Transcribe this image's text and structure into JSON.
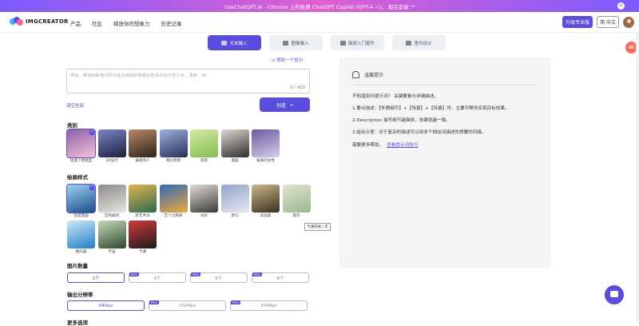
{
  "banner": {
    "text": "UseChatGPT.AI - Chrome 上的免费 ChatGPT Copilot (GPT-4 ✓)。 现在安装",
    "arrow": "→",
    "close": "×"
  },
  "brand": {
    "name": "IMGCREATOR",
    "colors": [
      "#3ab0ff",
      "#5b4ce0",
      "#ff5f8f"
    ]
  },
  "nav": {
    "items": [
      "产品",
      "社区",
      "释放你的想象力",
      "历史记录"
    ],
    "pro": "升级专业版",
    "lang": "简 中文"
  },
  "modes": [
    {
      "label": "文本输入",
      "icon": "text-icon",
      "active": true
    },
    {
      "label": "图像输入",
      "icon": "image-icon",
      "active": false
    },
    {
      "label": "面部入门套件",
      "icon": "face-icon",
      "active": false
    },
    {
      "label": "室内设计",
      "icon": "home-icon",
      "active": false
    }
  ],
  "prompt": {
    "random": "⊙ 随机一个提示",
    "placeholder": "例如，樱花树和落日时分站在窗前的穿着白色毛衣的可爱少女，清晰，4k",
    "count": "0 / 400",
    "clear": "清空全部",
    "create": "创造",
    "create_arrow": "→"
  },
  "category": {
    "title": "类别",
    "items": [
      {
        "label": "动漫人物类型",
        "colors": [
          "#f6c1d6",
          "#8b5fa8"
        ],
        "selected": true
      },
      {
        "label": "3D设计",
        "colors": [
          "#1b1f3a",
          "#7a86c9"
        ],
        "selected": false
      },
      {
        "label": "逼真男人",
        "colors": [
          "#2e211b",
          "#b88a66"
        ],
        "selected": false
      },
      {
        "label": "奇幻场景",
        "colors": [
          "#27305a",
          "#9bb3dd"
        ],
        "selected": false
      },
      {
        "label": "风景",
        "colors": [
          "#7fbf4d",
          "#d9e8a6"
        ],
        "selected": false
      },
      {
        "label": "漫画",
        "colors": [
          "#2d2d2d",
          "#ddd7cf"
        ],
        "selected": false
      },
      {
        "label": "逼真的女性",
        "colors": [
          "#d6cfe8",
          "#6b5aa3"
        ],
        "selected": false
      }
    ]
  },
  "style": {
    "title": "绘画样式",
    "items": [
      {
        "label": "动漫漫画",
        "colors": [
          "#1b4b8a",
          "#9ad3f0"
        ],
        "selected": true
      },
      {
        "label": "宫崎骏风",
        "colors": [
          "#e9e6e0",
          "#8a8a8a"
        ],
        "selected": false
      },
      {
        "label": "新艺术派",
        "colors": [
          "#2a6b4f",
          "#e2b34a"
        ],
        "selected": false
      },
      {
        "label": "吉卜力风格",
        "colors": [
          "#f0a73a",
          "#2c6bb8"
        ],
        "selected": false
      },
      {
        "label": "水彩",
        "colors": [
          "#3a3a3a",
          "#e2dcd2"
        ],
        "selected": false
      },
      {
        "label": "梦幻",
        "colors": [
          "#e9e5ef",
          "#8fa6c9"
        ],
        "selected": false
      },
      {
        "label": "毕加索",
        "colors": [
          "#3a3020",
          "#c9b68a"
        ],
        "selected": false
      },
      {
        "label": "莫奈",
        "colors": [
          "#9bb98c",
          "#e2e2cf"
        ],
        "selected": false
      },
      {
        "label": "数码画",
        "colors": [
          "#1f7fc9",
          "#cde8f6"
        ],
        "selected": false
      },
      {
        "label": "宇宙",
        "colors": [
          "#2b4a2a",
          "#c6d9b9"
        ],
        "selected": false
      },
      {
        "label": "卡通",
        "colors": [
          "#1b1b1b",
          "#d33a3a"
        ],
        "selected": false
      }
    ],
    "tooltip": "卡通风格 | 无"
  },
  "count_opts": {
    "title": "图片数量",
    "items": [
      {
        "label": "2个",
        "badge": "",
        "selected": true
      },
      {
        "label": "4个",
        "badge": "PRO",
        "selected": false
      },
      {
        "label": "6个",
        "badge": "PRO",
        "selected": false
      },
      {
        "label": "8个",
        "badge": "PRO",
        "selected": false
      }
    ]
  },
  "res_opts": {
    "title": "输出分辨率",
    "items": [
      {
        "label": "640px",
        "badge": "",
        "selected": true
      },
      {
        "label": "1024px",
        "badge": "PRO",
        "selected": false
      },
      {
        "label": "2048px",
        "badge": "PRO",
        "selected": false
      }
    ]
  },
  "more": {
    "title": "更多选项"
  },
  "tips": {
    "title": "温馨提示",
    "lines": [
      "不知道如何提示词？ 关键要素与详细描述。",
      "1.要点描述：【外貌细节】+【场景】+【风格】时，主要可帮你实现目标效果。",
      "2.Description 描写细节越具体，效果就越一致。",
      "3.给出示意：对于复杂的描述可以用多个相似词描述你想要的风格。"
    ],
    "link_pre": "需要更多帮助，",
    "link": "查看提示词技巧"
  }
}
